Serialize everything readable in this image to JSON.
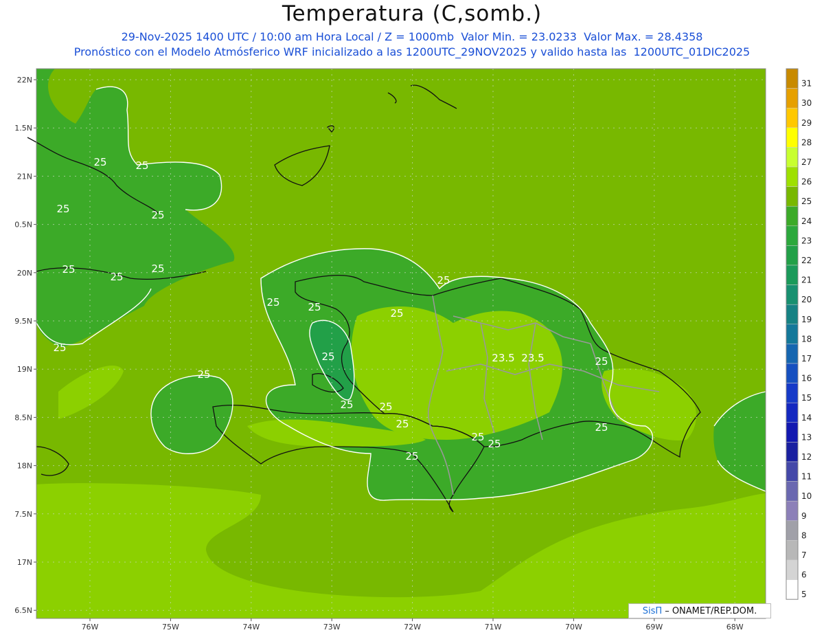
{
  "header": {
    "title": "Temperatura (C,somb.)",
    "subtitle1": "29-Nov-2025 1400 UTC / 10:00 am Hora Local / Z = 1000mb  Valor Min. = 23.0233  Valor Max. = 28.4358",
    "subtitle2": "Pronóstico con el Modelo Atmósferico WRF inicializado a las 1200UTC_29NOV2025 y valido hasta las  1200UTC_01DIC2025"
  },
  "axes": {
    "lat_labels": [
      "22N",
      "1.5N",
      "21N",
      "0.5N",
      "20N",
      "9.5N",
      "19N",
      "8.5N",
      "18N",
      "7.5N",
      "17N",
      "6.5N"
    ],
    "lon_labels": [
      "76W",
      "75W",
      "74W",
      "73W",
      "72W",
      "71W",
      "70W",
      "69W",
      "68W"
    ]
  },
  "contour_labels": [
    "25",
    "25",
    "25",
    "25",
    "25",
    "25",
    "25",
    "25",
    "25",
    "25",
    "25",
    "25",
    "25",
    "23.5",
    "23.5",
    "25",
    "25",
    "25",
    "25",
    "25",
    "25",
    "25",
    "25",
    "25"
  ],
  "colorbar": {
    "levels": [
      "31",
      "30",
      "29",
      "28",
      "27",
      "26",
      "25",
      "24",
      "23",
      "22",
      "21",
      "20",
      "19",
      "18",
      "17",
      "16",
      "15",
      "14",
      "13",
      "12",
      "11",
      "10",
      "9",
      "8",
      "7",
      "6",
      "5"
    ],
    "colors": [
      "#c88a00",
      "#e6a000",
      "#ffc800",
      "#ffff00",
      "#c8ff30",
      "#9ee000",
      "#78b800",
      "#3caa28",
      "#2ca83c",
      "#22a048",
      "#1b9a5a",
      "#189070",
      "#168284",
      "#14789a",
      "#1666b0",
      "#1650c0",
      "#163ac8",
      "#1428c0",
      "#1218b0",
      "#1a20a0",
      "#4448a8",
      "#6a68b0",
      "#8c80b8",
      "#a0a0a8",
      "#b8b8b8",
      "#d4d4d4",
      "#ffffff"
    ]
  },
  "credit": {
    "logo": "SisΠ",
    "text": " – ONAMET/REP.DOM."
  }
}
